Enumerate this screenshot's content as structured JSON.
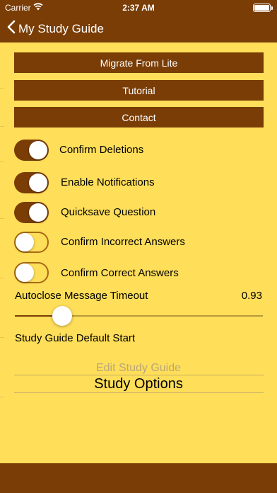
{
  "status_bar": {
    "carrier": "Carrier",
    "time": "2:37 AM"
  },
  "nav": {
    "back_label": "My Study Guide"
  },
  "buttons": {
    "migrate": "Migrate From Lite",
    "tutorial": "Tutorial",
    "contact": "Contact"
  },
  "toggles": [
    {
      "label": "Confirm Deletions",
      "on": true
    },
    {
      "label": "Enable Notifications",
      "on": true
    },
    {
      "label": "Quicksave Question",
      "on": true
    },
    {
      "label": "Confirm Incorrect Answers",
      "on": false
    },
    {
      "label": "Confirm Correct Answers",
      "on": false
    }
  ],
  "slider": {
    "label": "Autoclose Message Timeout",
    "value": "0.93",
    "fraction": 0.19
  },
  "picker": {
    "label": "Study Guide Default Start",
    "options": [
      "Edit Study Guide",
      "Study Options"
    ],
    "selected": "Study Options"
  },
  "colors": {
    "accent": "#7a3d06",
    "background": "#ffde59"
  },
  "icons": {
    "back": "chevron-left-icon",
    "wifi": "wifi-icon",
    "battery": "battery-icon"
  }
}
